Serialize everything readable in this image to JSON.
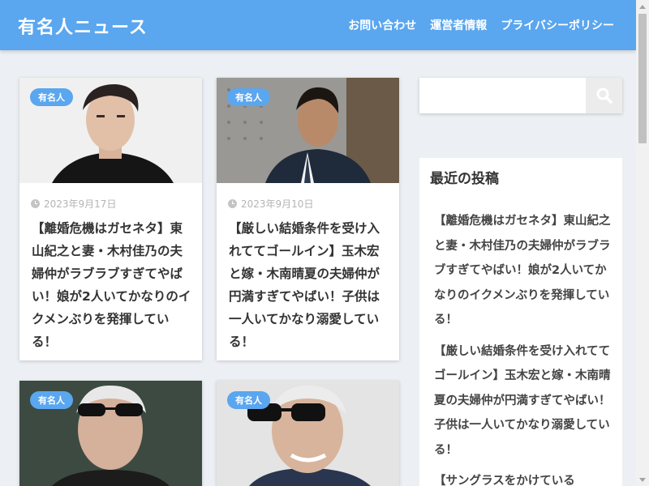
{
  "header": {
    "site_title": "有名人ニュース",
    "nav": [
      "お問い合わせ",
      "運営者情報",
      "プライバシーポリシー"
    ]
  },
  "posts": [
    {
      "badge": "有名人",
      "date": "2023年9月17日",
      "title": "【離婚危機はガセネタ】東山紀之と妻・木村佳乃の夫婦仲がラブラブすぎてやばい！娘が2人いてかなりのイクメンぶりを発揮している！"
    },
    {
      "badge": "有名人",
      "date": "2023年9月10日",
      "title": "【厳しい結婚条件を受け入れててゴールイン】玉木宏と嫁・木南晴夏の夫婦仲が円満すぎてやばい！子供は一人いてかなり溺愛している！"
    },
    {
      "badge": "有名人"
    },
    {
      "badge": "有名人"
    }
  ],
  "sidebar": {
    "search_placeholder": "",
    "widget_title": "最近の投稿",
    "recent_posts": [
      "【離婚危機はガセネタ】東山紀之と妻・木村佳乃の夫婦仲がラブラブすぎてやばい！娘が2人いてかなりのイクメンぶりを発揮している！",
      "【厳しい結婚条件を受け入れててゴールイン】玉木宏と嫁・木南晴夏の夫婦仲が円満すぎてやばい！子供は一人いてかなり溺愛している！",
      "【サングラスをかけている"
    ]
  },
  "colors": {
    "accent": "#5aa6ef",
    "background": "#eceff3"
  }
}
